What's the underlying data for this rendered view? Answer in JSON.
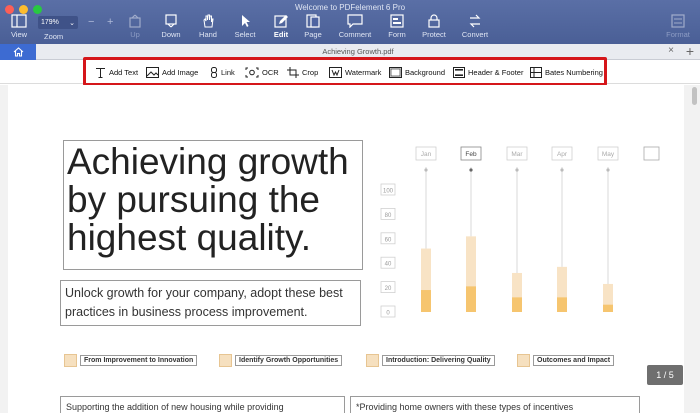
{
  "window": {
    "title": "Welcome to PDFelement 6 Pro",
    "traffic_colors": [
      "#fc5f57",
      "#fdbc2e",
      "#28c841"
    ]
  },
  "toolbar": {
    "zoom_value": "179%",
    "items": [
      {
        "key": "view",
        "label": "View",
        "icon": "view-icon",
        "enabled": true
      },
      {
        "key": "zoom",
        "label": "Zoom"
      },
      {
        "key": "up",
        "label": "Up",
        "icon": "up-icon",
        "enabled": false
      },
      {
        "key": "down",
        "label": "Down",
        "icon": "down-icon",
        "enabled": true
      },
      {
        "key": "hand",
        "label": "Hand",
        "icon": "hand-icon",
        "enabled": true
      },
      {
        "key": "select",
        "label": "Select",
        "icon": "select-icon",
        "enabled": true
      },
      {
        "key": "edit",
        "label": "Edit",
        "icon": "edit-icon",
        "enabled": true
      },
      {
        "key": "page",
        "label": "Page",
        "icon": "page-icon",
        "enabled": true
      },
      {
        "key": "comment",
        "label": "Comment",
        "icon": "comment-icon",
        "enabled": true
      },
      {
        "key": "form",
        "label": "Form",
        "icon": "form-icon",
        "enabled": true
      },
      {
        "key": "protect",
        "label": "Protect",
        "icon": "protect-icon",
        "enabled": true
      },
      {
        "key": "convert",
        "label": "Convert",
        "icon": "convert-icon",
        "enabled": true
      },
      {
        "key": "format",
        "label": "Format",
        "icon": "format-icon",
        "enabled": false
      }
    ]
  },
  "tabs": {
    "document_tab": "Achieving Growth.pdf",
    "close": "×",
    "add": "+"
  },
  "edit_tools": [
    {
      "label": "Add Text",
      "icon": "text-icon"
    },
    {
      "label": "Add Image",
      "icon": "image-icon"
    },
    {
      "label": "Link",
      "icon": "link-icon"
    },
    {
      "label": "OCR",
      "icon": "ocr-icon"
    },
    {
      "label": "Crop",
      "icon": "crop-icon"
    },
    {
      "label": "Watermark",
      "icon": "watermark-icon"
    },
    {
      "label": "Background",
      "icon": "background-icon"
    },
    {
      "label": "Header & Footer",
      "icon": "header-footer-icon"
    },
    {
      "label": "Bates Numbering",
      "icon": "bates-numbering-icon"
    }
  ],
  "document": {
    "headline_lines": [
      "Achieving growth",
      "by pursuing the",
      "highest quality."
    ],
    "subtitle_lines": [
      "Unlock growth for your company, adopt these best",
      "practices in business process improvement."
    ],
    "sections": [
      "From Improvement to Innovation",
      "Identify Growth Opportunities",
      "Introduction: Delivering Quality",
      "Outcomes and Impact"
    ],
    "bottom_left": "Supporting the addition of new housing while providing",
    "bottom_right": "*Providing home owners with these types of incentives",
    "page_indicator": "1 / 5"
  },
  "chart_data": {
    "type": "bar",
    "categories": [
      "Jan",
      "Feb",
      "Mar",
      "Apr",
      "May"
    ],
    "series": [
      {
        "values": [
          52,
          62,
          32,
          37,
          23
        ]
      },
      {
        "values": [
          18,
          21,
          12,
          12,
          6
        ]
      }
    ],
    "yticks": [
      "100",
      "80",
      "60",
      "40",
      "20",
      "0"
    ],
    "ylim": [
      0,
      100
    ],
    "colors": {
      "light": "#f8e3c5",
      "dark": "#f6c56f",
      "line": "#d8d8d8"
    }
  }
}
